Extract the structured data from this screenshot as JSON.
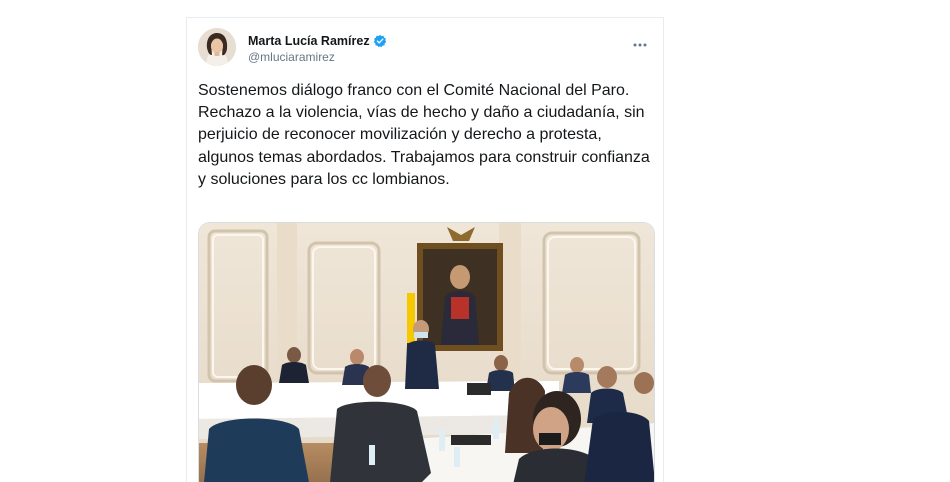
{
  "tweet": {
    "display_name": "Marta Lucía Ramírez",
    "handle": "@mluciaramirez",
    "verified_icon": "verified-badge-icon",
    "more_icon": "more-options-icon",
    "text": "Sostenemos diálogo franco con el Comité Nacional del Paro. Rechazo a la violencia, vías de hecho y daño a ciudadanía, sin perjuicio de reconocer movilización y derecho a protesta, algunos temas abordados. Trabajamos para construir confianza y soluciones para los cc lombianos.",
    "media_description": "photo"
  },
  "colors": {
    "verified_blue": "#1da1f2",
    "text_primary": "#14171a",
    "text_secondary": "#657786",
    "border": "#e6ecf0"
  }
}
